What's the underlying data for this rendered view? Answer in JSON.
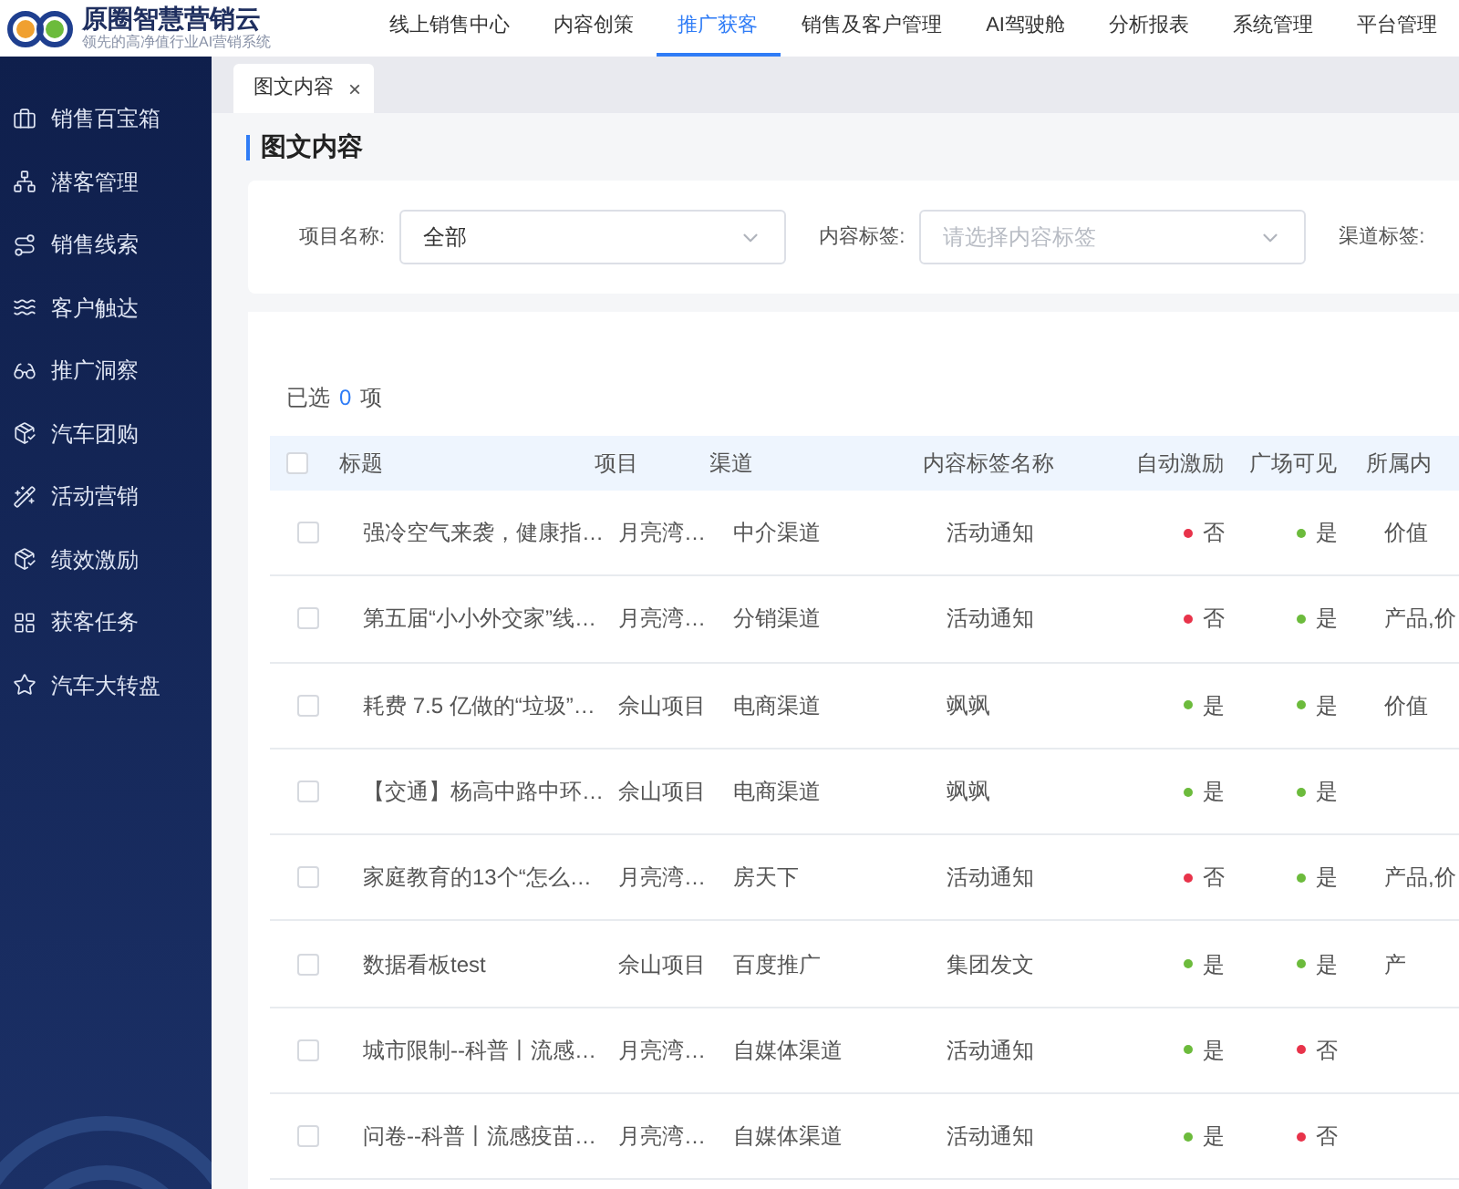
{
  "brand": {
    "name": "原圈智慧营销云",
    "tagline": "领先的高净值行业AI营销系统"
  },
  "top_nav": [
    {
      "label": "线上销售中心",
      "selected": false
    },
    {
      "label": "内容创策",
      "selected": false
    },
    {
      "label": "推广获客",
      "selected": true
    },
    {
      "label": "销售及客户管理",
      "selected": false
    },
    {
      "label": "AI驾驶舱",
      "selected": false
    },
    {
      "label": "分析报表",
      "selected": false
    },
    {
      "label": "系统管理",
      "selected": false
    },
    {
      "label": "平台管理",
      "selected": false
    }
  ],
  "sidebar": {
    "items": [
      {
        "label": "销售百宝箱"
      },
      {
        "label": "潜客管理"
      },
      {
        "label": "销售线索"
      },
      {
        "label": "客户触达"
      },
      {
        "label": "推广洞察"
      },
      {
        "label": "汽车团购"
      },
      {
        "label": "活动营销"
      },
      {
        "label": "绩效激励"
      },
      {
        "label": "获客任务"
      },
      {
        "label": "汽车大转盘"
      }
    ]
  },
  "tabs": [
    {
      "label": "图文内容",
      "close": "×"
    }
  ],
  "page_title": "图文内容",
  "filters": [
    {
      "label": "项目名称:",
      "value": "全部"
    },
    {
      "label": "内容标签:",
      "placeholder": "请选择内容标签"
    },
    {
      "label": "渠道标签:"
    }
  ],
  "selection": {
    "prefix": "已选",
    "count": "0",
    "suffix": "项"
  },
  "table": {
    "all_checked": false,
    "columns": [
      "标题",
      "项目",
      "渠道",
      "内容标签名称",
      "自动激励",
      "广场可见",
      "所属内"
    ],
    "rows": [
      {
        "checked": false,
        "title": "强冷空气来袭，健康指…",
        "project": "月亮湾…",
        "channel": "中介渠道",
        "tag": "活动通知",
        "auto": {
          "text": "否",
          "color": "#e8334a"
        },
        "visible": {
          "text": "是",
          "color": "#6cbb3c"
        },
        "column_7": "价值"
      },
      {
        "checked": false,
        "title": "第五届“小小外交家”线…",
        "project": "月亮湾…",
        "channel": "分销渠道",
        "tag": "活动通知",
        "auto": {
          "text": "否",
          "color": "#e8334a"
        },
        "visible": {
          "text": "是",
          "color": "#6cbb3c"
        },
        "column_7": "产品,价"
      },
      {
        "checked": false,
        "title": "耗费 7.5 亿做的“垃圾”…",
        "project": "佘山项目",
        "channel": "电商渠道",
        "tag": "飒飒",
        "auto": {
          "text": "是",
          "color": "#6cbb3c"
        },
        "visible": {
          "text": "是",
          "color": "#6cbb3c"
        },
        "column_7": "价值"
      },
      {
        "checked": false,
        "title": "【交通】杨高中路中环…",
        "project": "佘山项目",
        "channel": "电商渠道",
        "tag": "飒飒",
        "auto": {
          "text": "是",
          "color": "#6cbb3c"
        },
        "visible": {
          "text": "是",
          "color": "#6cbb3c"
        }
      },
      {
        "checked": false,
        "title": "家庭教育的13个“怎么…",
        "project": "月亮湾…",
        "channel": "房天下",
        "tag": "活动通知",
        "auto": {
          "text": "否",
          "color": "#e8334a"
        },
        "visible": {
          "text": "是",
          "color": "#6cbb3c"
        },
        "column_7": "产品,价"
      },
      {
        "checked": false,
        "title": "数据看板test",
        "project": "佘山项目",
        "channel": "百度推广",
        "tag": "集团发文",
        "auto": {
          "text": "是",
          "color": "#6cbb3c"
        },
        "visible": {
          "text": "是",
          "color": "#6cbb3c"
        },
        "column_7": "产"
      },
      {
        "checked": false,
        "title": "城市限制--科普丨流感…",
        "project": "月亮湾…",
        "channel": "自媒体渠道",
        "tag": "活动通知",
        "auto": {
          "text": "是",
          "color": "#6cbb3c"
        },
        "visible": {
          "text": "否",
          "color": "#e8334a"
        }
      },
      {
        "checked": false,
        "title": "问卷--科普丨流感疫苗…",
        "project": "月亮湾…",
        "channel": "自媒体渠道",
        "tag": "活动通知",
        "auto": {
          "text": "是",
          "color": "#6cbb3c"
        },
        "visible": {
          "text": "否",
          "color": "#e8334a"
        }
      }
    ]
  }
}
